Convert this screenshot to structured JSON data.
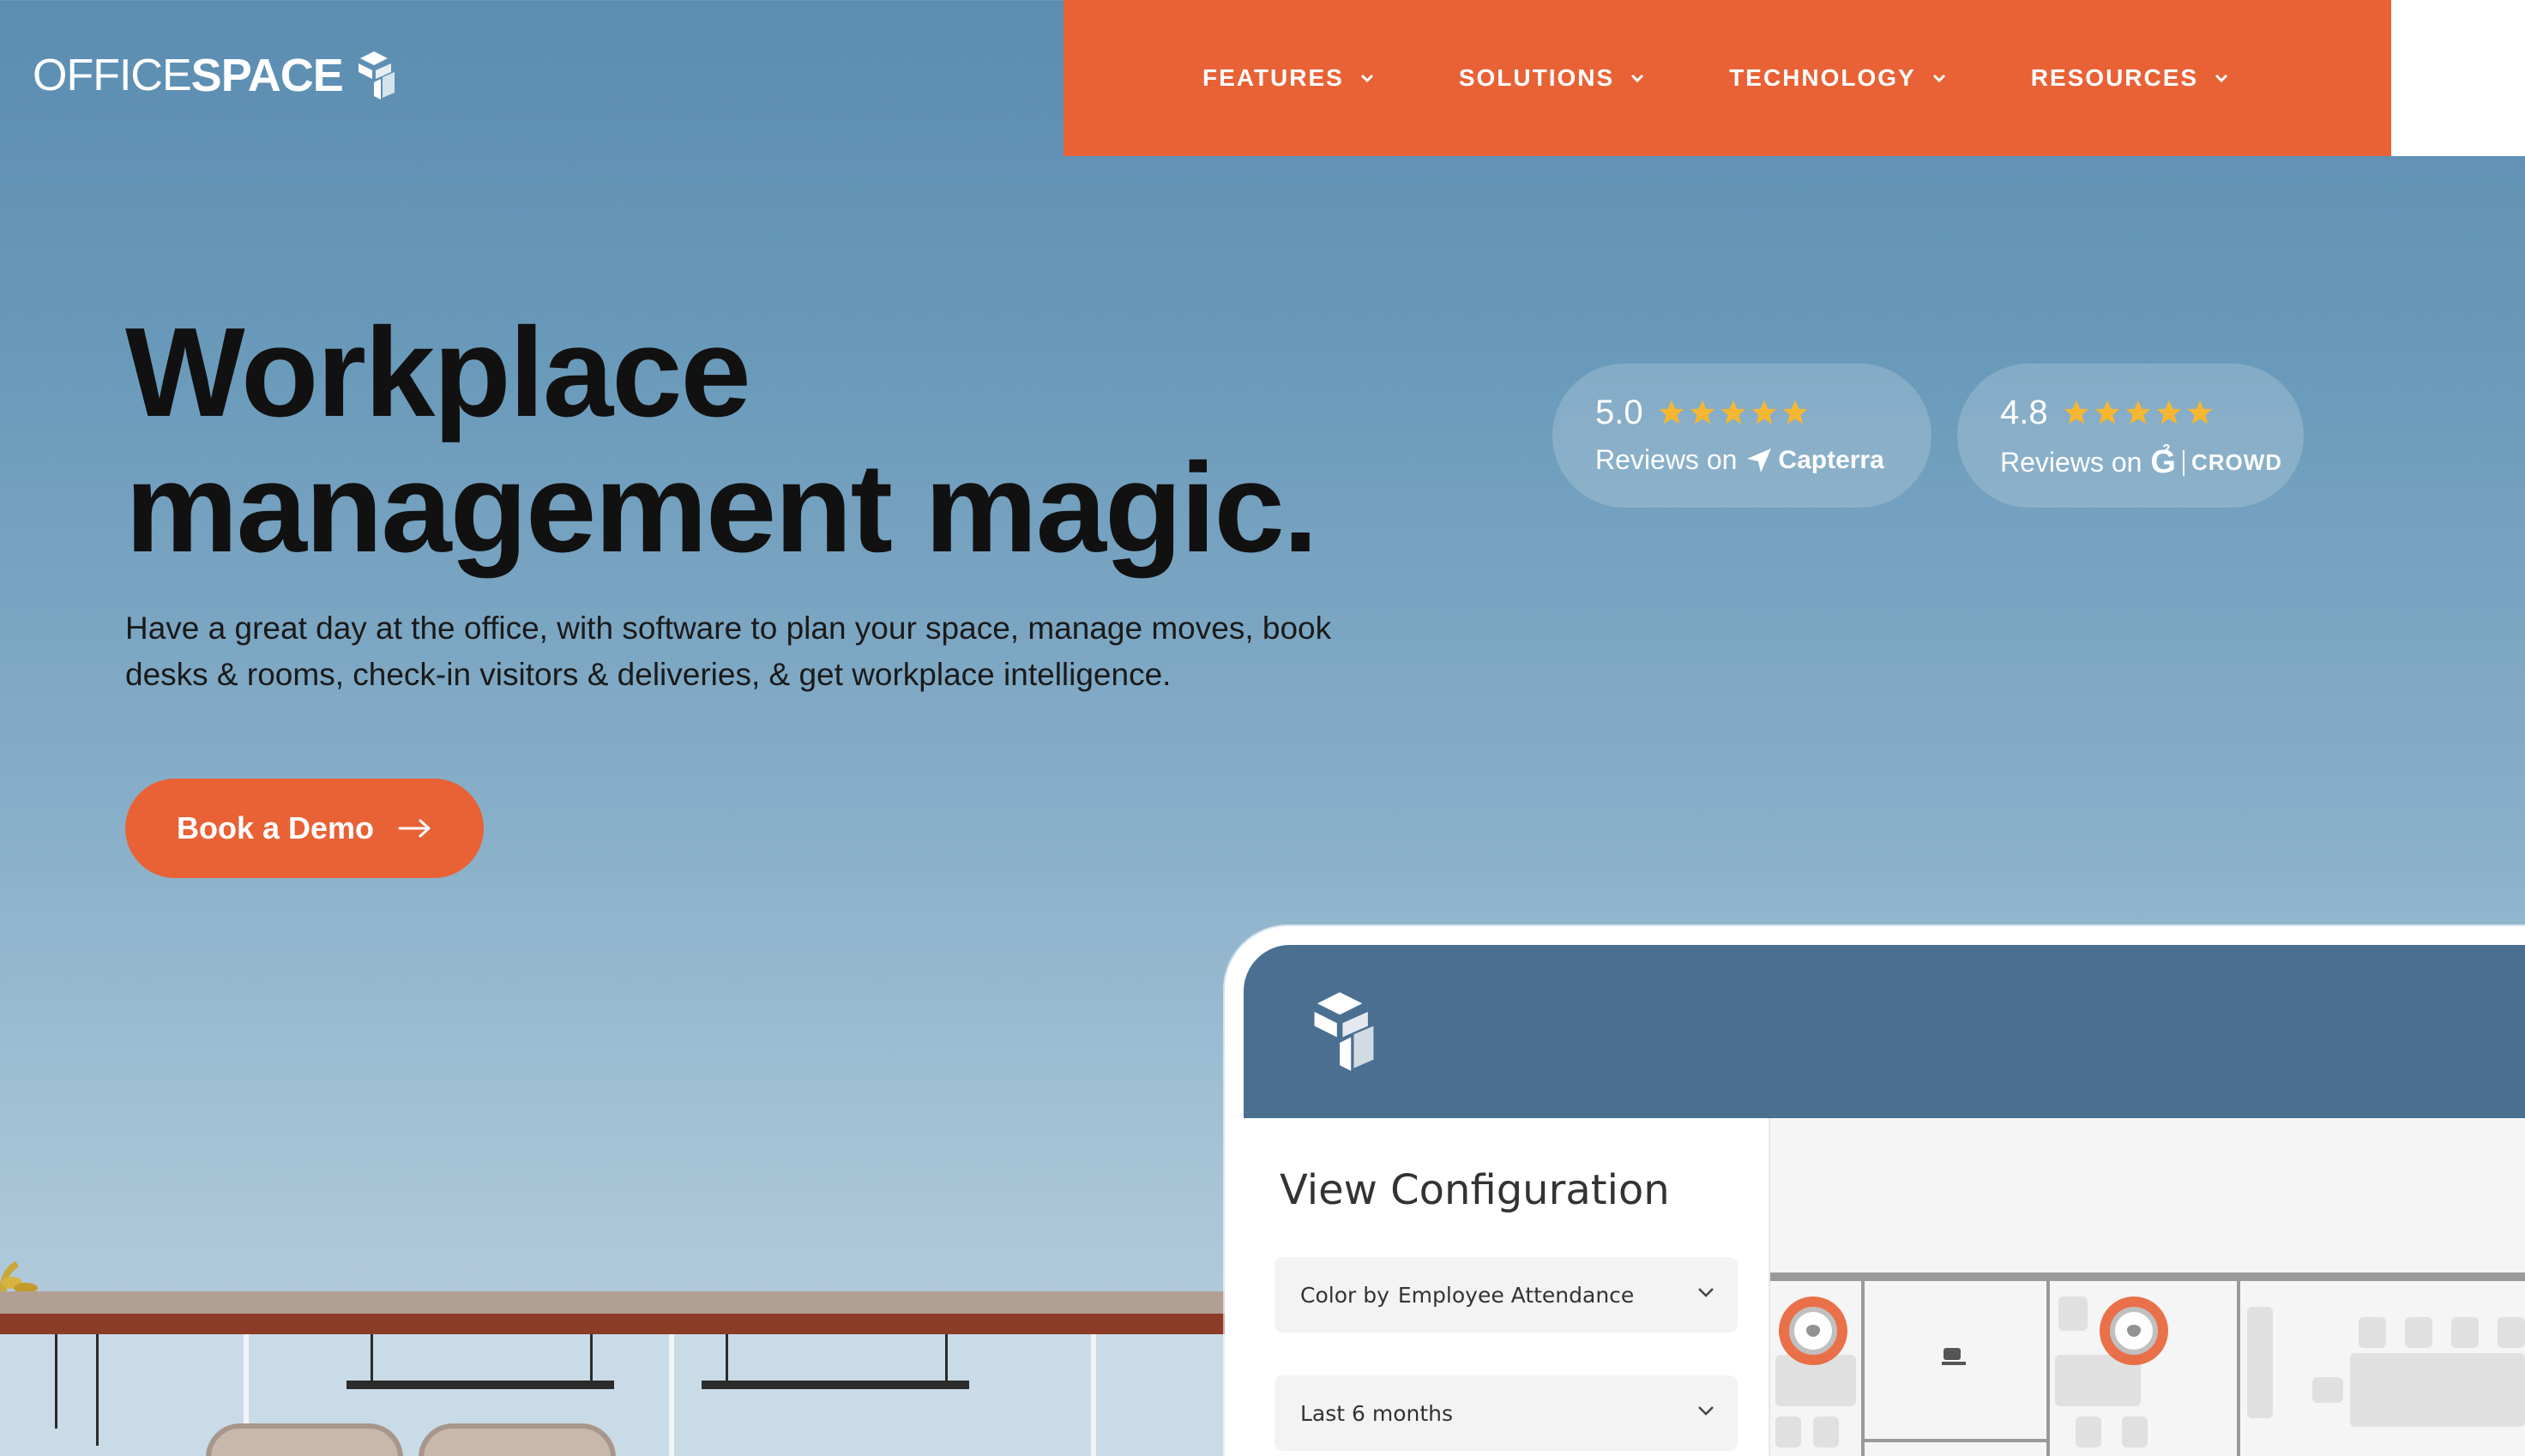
{
  "header": {
    "logo_office": "OFFICE",
    "logo_space": "SPACE",
    "nav": [
      {
        "label": "FEATURES"
      },
      {
        "label": "SOLUTIONS"
      },
      {
        "label": "TECHNOLOGY"
      },
      {
        "label": "RESOURCES"
      }
    ]
  },
  "hero": {
    "headline_line1": "Workplace",
    "headline_line2": "management magic.",
    "subtext": "Have a great day at the office, with software to plan your space, manage moves, book desks & rooms, check-in visitors & deliveries, & get workplace intelligence.",
    "cta_label": "Book a Demo"
  },
  "reviews": [
    {
      "score": "5.0",
      "stars": 5,
      "prefix": "Reviews on",
      "brand": "Capterra"
    },
    {
      "score": "4.8",
      "stars": 5,
      "prefix": "Reviews on",
      "brand_mark": "G",
      "brand_sup": "2",
      "brand": "CROWD"
    }
  ],
  "app_preview": {
    "panel_title": "View Configuration",
    "color_by_label": "Color by",
    "color_by_value": "Employee Attendance",
    "range_value": "Last 6 months"
  },
  "colors": {
    "accent": "#e86236",
    "app_header": "#4a6f91",
    "star": "#f5b731"
  }
}
